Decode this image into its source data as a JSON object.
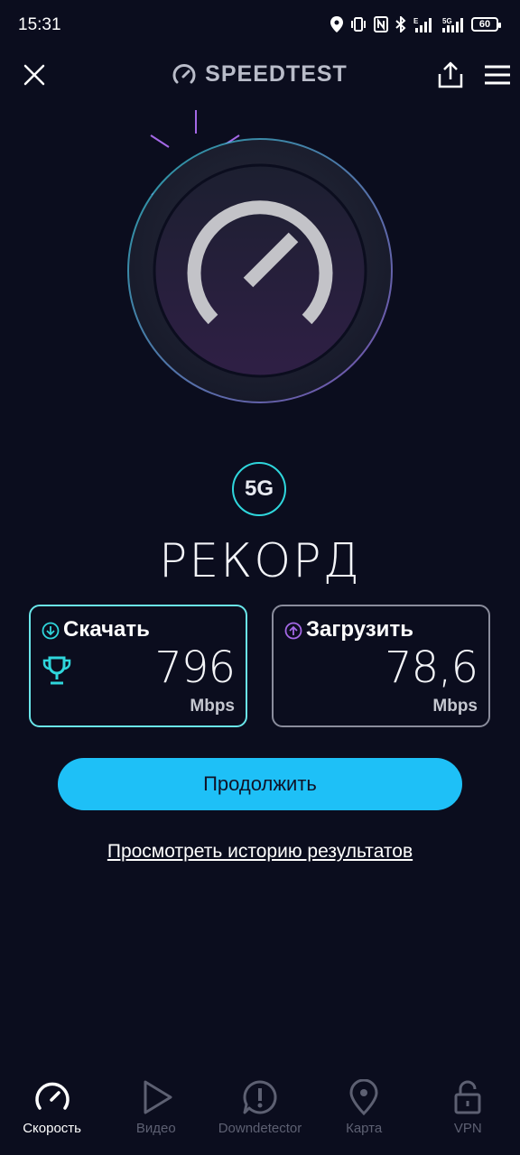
{
  "status_bar": {
    "time": "15:31",
    "battery": "60"
  },
  "header": {
    "title": "SPEEDTEST"
  },
  "network_badge": "5G",
  "result_title": "РЕКОРД",
  "download": {
    "label": "Скачать",
    "value": "796",
    "unit": "Mbps"
  },
  "upload": {
    "label": "Загрузить",
    "value": "78,6",
    "unit": "Mbps"
  },
  "continue_label": "Продолжить",
  "history_link": "Просмотреть историю результатов",
  "nav": [
    {
      "label": "Скорость",
      "icon": "gauge-icon",
      "active": true
    },
    {
      "label": "Видео",
      "icon": "play-icon",
      "active": false
    },
    {
      "label": "Downdetector",
      "icon": "alert-icon",
      "active": false
    },
    {
      "label": "Карта",
      "icon": "map-pin-icon",
      "active": false
    },
    {
      "label": "VPN",
      "icon": "lock-icon",
      "active": false
    }
  ],
  "colors": {
    "background": "#0b0d1e",
    "accent": "#1ec0f7",
    "teal": "#2fd6dc",
    "purple": "#a468e6"
  }
}
